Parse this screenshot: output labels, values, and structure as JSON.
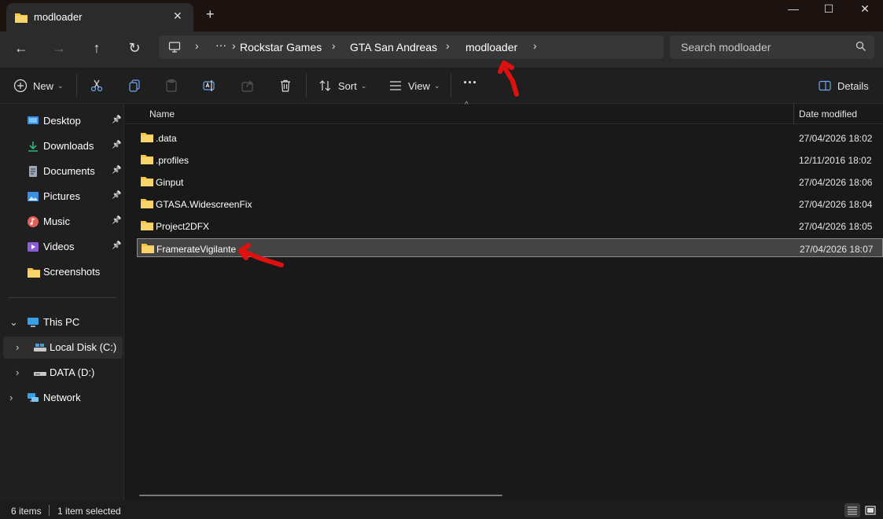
{
  "window": {
    "tab_title": "modloader",
    "new_tab_symbol": "+",
    "close_tab_symbol": "✕",
    "minimize_symbol": "—",
    "maximize_symbol": "☐",
    "close_symbol": "✕"
  },
  "navigation": {
    "back_symbol": "←",
    "forward_symbol": "→",
    "up_symbol": "↑",
    "refresh_symbol": "↻",
    "overflow": "···",
    "breadcrumbs": [
      "Rockstar Games",
      "GTA San Andreas",
      "modloader"
    ],
    "separator": "›"
  },
  "search": {
    "placeholder": "Search modloader"
  },
  "toolbar": {
    "new_label": "New",
    "sort_label": "Sort",
    "view_label": "View",
    "more_symbol": "···",
    "details_label": "Details"
  },
  "sidebar": {
    "quick_access": [
      {
        "label": "Desktop",
        "icon": "desktop-icon",
        "color": "#3a8ee6"
      },
      {
        "label": "Downloads",
        "icon": "download-icon",
        "color": "#2fb47c"
      },
      {
        "label": "Documents",
        "icon": "document-icon",
        "color": "#9aa8b8"
      },
      {
        "label": "Pictures",
        "icon": "pictures-icon",
        "color": "#3a8ee6"
      },
      {
        "label": "Music",
        "icon": "music-icon",
        "color": "#e0615a"
      },
      {
        "label": "Videos",
        "icon": "video-icon",
        "color": "#8b5cd6"
      },
      {
        "label": "Screenshots",
        "icon": "folder-icon",
        "color": "#f0c14b"
      }
    ],
    "this_pc": "This PC",
    "drives": [
      {
        "label": "Local Disk (C:)",
        "selected": true
      },
      {
        "label": "DATA (D:)",
        "selected": false
      }
    ],
    "network": "Network"
  },
  "content": {
    "col_name": "Name",
    "col_date": "Date modified",
    "rows": [
      {
        "name": ".data",
        "date": "27/04/2026 18:02"
      },
      {
        "name": ".profiles",
        "date": "12/11/2016 18:02"
      },
      {
        "name": "Ginput",
        "date": "27/04/2026 18:06"
      },
      {
        "name": "GTASA.WidescreenFix",
        "date": "27/04/2026 18:04"
      },
      {
        "name": "Project2DFX",
        "date": "27/04/2026 18:05"
      },
      {
        "name": "FramerateVigilante",
        "date": "27/04/2026 18:07",
        "selected": true
      }
    ]
  },
  "status": {
    "items_count": "6 items",
    "selection": "1 item selected"
  },
  "colors": {
    "folder": "#f5c542",
    "annotation": "#e01010",
    "accent": "#3a8ee6"
  }
}
